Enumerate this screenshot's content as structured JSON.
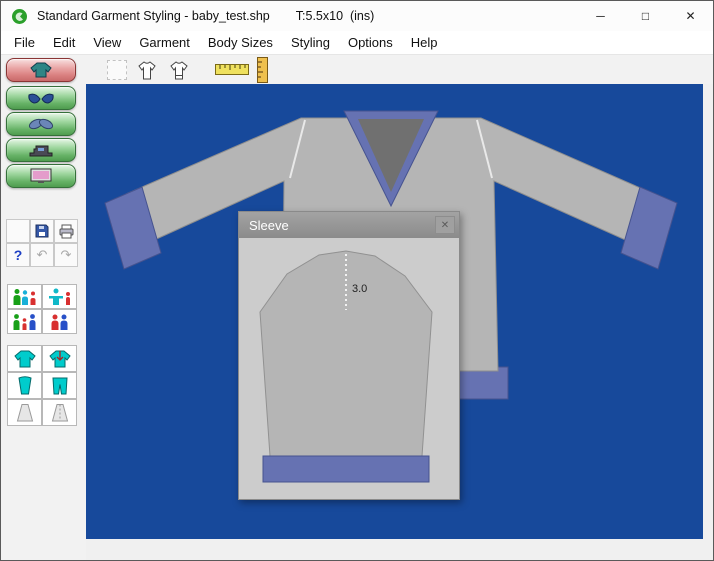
{
  "window": {
    "title": "Standard Garment Styling - baby_test.shp",
    "dims": "T:5.5x10  (ins)",
    "controls": {
      "minimize": "─",
      "maximize": "□",
      "close": "✕"
    }
  },
  "menu": {
    "items": [
      "File",
      "Edit",
      "View",
      "Garment",
      "Body Sizes",
      "Styling",
      "Options",
      "Help"
    ]
  },
  "toolbar": {
    "icons": [
      "selection-rect",
      "garment-outline",
      "garment-trim-outline",
      "horizontal-ruler",
      "vertical-ruler"
    ]
  },
  "sidebar": {
    "mode_buttons": [
      "garment-style",
      "collar-style",
      "sleeve-style",
      "hem-style",
      "screen-preview"
    ],
    "file_tools": [
      "save",
      "print"
    ],
    "help_glyph": "?",
    "undo_glyph": "↶",
    "redo_glyph": "↷",
    "body_tools": [
      "size-group",
      "size-measure",
      "size-family",
      "size-pair"
    ],
    "garment_tools": [
      "knit-top",
      "knit-top-marked",
      "sleeve-piece",
      "pants-piece",
      "skirt-piece",
      "skirt-piece-lined"
    ]
  },
  "dialog": {
    "title": "Sleeve",
    "close_glyph": "✕",
    "measurement": "3.0"
  },
  "colors": {
    "canvas_blue": "#17499b",
    "garment_gray": "#b5b5b5",
    "trim_purple": "#6672b2",
    "trim_purple_dark": "#46538f",
    "collar_inner": "#707070",
    "seam_white": "#e9e9e9",
    "dialog_body": "#cccccc",
    "dialog_titlebar": "#8f8f8f",
    "sleeve_dash": "#f2f2f2",
    "measure_text": "#222222",
    "active_button_red": "#dc8a8a",
    "button_green": "#7cc47c",
    "tool_cyan": "#00cccc"
  }
}
